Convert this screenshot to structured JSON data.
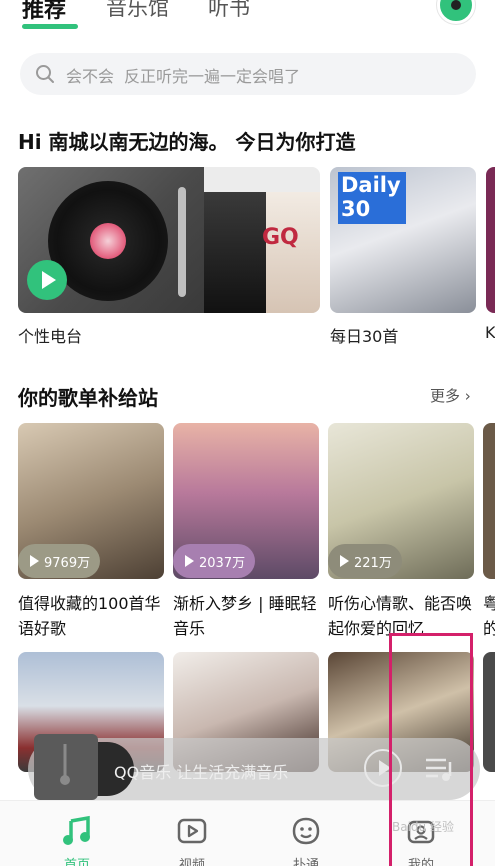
{
  "top_tabs": {
    "recommend": "推荐",
    "music_hall": "音乐馆",
    "audiobook": "听书"
  },
  "search": {
    "keyword": "会不会",
    "hint": "反正听完一遍一定会唱了"
  },
  "greeting": "Hi 南城以南无边的海。 今日为你打造",
  "daily_cards": [
    {
      "label": "个性电台"
    },
    {
      "label": "每日30首",
      "logo_line1": "Daily",
      "logo_line2": "30",
      "partial_label": "K"
    }
  ],
  "radio_card": {
    "gq_text": "GQ"
  },
  "playlist_section": {
    "title": "你的歌单补给站",
    "more": "更多"
  },
  "playlists": [
    {
      "title": "值得收藏的100首华语好歌",
      "plays": "9769万"
    },
    {
      "title": "渐析入梦乡 | 睡眠轻音乐",
      "plays": "2037万"
    },
    {
      "title": "听伤心情歌、能否唤起你爱的回忆",
      "plays": "221万"
    },
    {
      "title_partial": "粤 的"
    }
  ],
  "mini_player": {
    "text": "QQ音乐 让生活充满音乐"
  },
  "bottom_nav": [
    {
      "label": "首页",
      "icon": "music-note-icon",
      "active": true
    },
    {
      "label": "视频",
      "icon": "video-play-icon",
      "active": false
    },
    {
      "label": "扑通",
      "icon": "chat-face-icon",
      "active": false
    },
    {
      "label": "我的",
      "icon": "profile-icon",
      "active": false
    }
  ],
  "watermark": "Baidu 经验",
  "colors": {
    "accent": "#31c27c",
    "highlight_box": "#d4206a"
  }
}
